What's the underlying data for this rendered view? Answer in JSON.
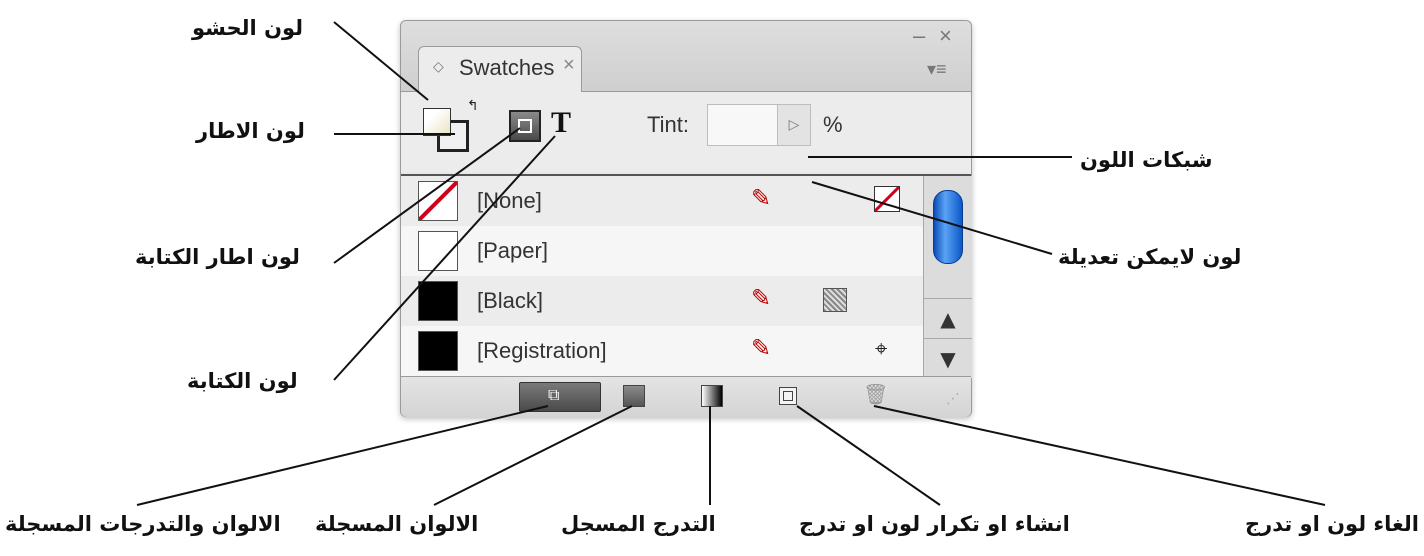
{
  "panel": {
    "tab_title": "Swatches",
    "tab_close": "×",
    "tab_updown": "◇",
    "minimize": "–",
    "close": "×",
    "menu_icon": "▾≡",
    "tint_label": "Tint:",
    "tint_value": "",
    "tint_unit": "%",
    "text_toggle": "T",
    "swatches": [
      {
        "name": "[None]",
        "swatch": "none"
      },
      {
        "name": "[Paper]",
        "swatch": "#ffffff"
      },
      {
        "name": "[Black]",
        "swatch": "#000000"
      },
      {
        "name": "[Registration]",
        "swatch": "#000000"
      }
    ],
    "scroll_up": "▲",
    "scroll_down": "▼"
  },
  "labels": {
    "fill": "لون الحشو",
    "stroke": "لون الاطار",
    "text_stroke": "لون اطار الكتابة",
    "text": "لون الكتابة",
    "tint": "شبكات اللون",
    "not_editable": "لون لايمكن تعديلة",
    "all_registered": "الالوان والتدرجات المسجلة",
    "registered_colors": "الالوان المسجلة",
    "registered_gradient": "التدرج المسجل",
    "new_swatch": "انشاء او تكرار لون او تدرج",
    "delete_swatch": "الغاء لون او تدرج"
  },
  "colors": {
    "thumb": "#1e6fe0",
    "none_slash": "#d0021b"
  }
}
